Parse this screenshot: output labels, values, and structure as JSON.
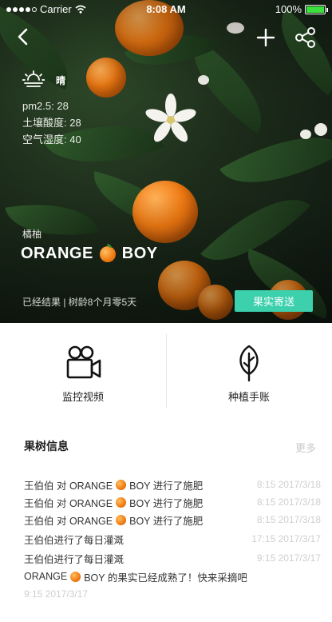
{
  "status_bar": {
    "carrier": "Carrier",
    "time": "8:08 AM",
    "battery": "100%",
    "battery_color": "#3ce03c",
    "icons": [
      "signal-dots-icon",
      "wifi-icon",
      "battery-icon"
    ]
  },
  "nav": {
    "icons": [
      "back-icon",
      "add-icon",
      "share-icon"
    ]
  },
  "weather": {
    "icon": "sun-haze-icon",
    "condition": "晴",
    "pm25": "pm2.5: 28",
    "soil_acidity": "土壤酸度: 28",
    "air_humidity": "空气湿度: 40"
  },
  "tree": {
    "name": "橘柚",
    "title_left": "ORANGE",
    "title_right": "BOY",
    "status": "已经结果 | 树龄8个月零5天",
    "ship_button": "果实寄送",
    "accent": "#3cd0ad"
  },
  "functions": [
    {
      "label": "监控视频",
      "icon": "video-camera-icon"
    },
    {
      "label": "种植手账",
      "icon": "leaf-icon"
    }
  ],
  "info": {
    "title": "果树信息",
    "more": "更多",
    "records": [
      {
        "pre": "王伯伯 对 ORANGE",
        "post": "BOY 进行了施肥",
        "orange": true,
        "time": "8:15 2017/3/18"
      },
      {
        "pre": "王伯伯 对 ORANGE",
        "post": "BOY 进行了施肥",
        "orange": true,
        "time": "8:15 2017/3/18"
      },
      {
        "pre": "王伯伯 对 ORANGE",
        "post": "BOY 进行了施肥",
        "orange": true,
        "time": "8:15 2017/3/18"
      },
      {
        "pre": "王伯伯进行了每日灌溉",
        "post": "",
        "orange": false,
        "time": "17:15 2017/3/17"
      },
      {
        "pre": "王伯伯进行了每日灌溉",
        "post": "",
        "orange": false,
        "time": "9:15 2017/3/17"
      },
      {
        "pre": "ORANGE",
        "post": "BOY 的果实已经成熟了！快来采摘吧",
        "orange": true,
        "time": ""
      }
    ],
    "last_time": "9:15 2017/3/17"
  }
}
